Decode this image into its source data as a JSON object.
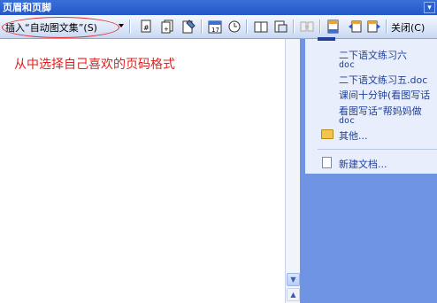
{
  "toolbar": {
    "title": "页眉和页脚",
    "insert_autotext_label": "插入“自动图文集”(S)",
    "close_label": "关闭(C)",
    "icons": [
      "insert-page-number-icon",
      "insert-page-count-icon",
      "format-page-number-icon",
      "insert-date-icon",
      "insert-time-icon",
      "page-setup-icon",
      "show-hide-text-icon",
      "same-as-previous-icon",
      "switch-header-footer-icon",
      "show-previous-icon",
      "show-next-icon"
    ]
  },
  "document": {
    "annotation_text": "从中选择自己喜欢的页码格式",
    "annotation_color": "#e02020"
  },
  "task_pane": {
    "recent_files": [
      {
        "name": "二下语文练习六",
        "ext": "doc"
      },
      {
        "name": "二下语文练习五.doc",
        "ext": ""
      },
      {
        "name": "课间十分钟(看图写话",
        "ext": ""
      },
      {
        "name": "看图写话“帮妈妈做",
        "ext": "doc"
      }
    ],
    "more_label": "其他...",
    "new_doc_label": "新建文档..."
  }
}
